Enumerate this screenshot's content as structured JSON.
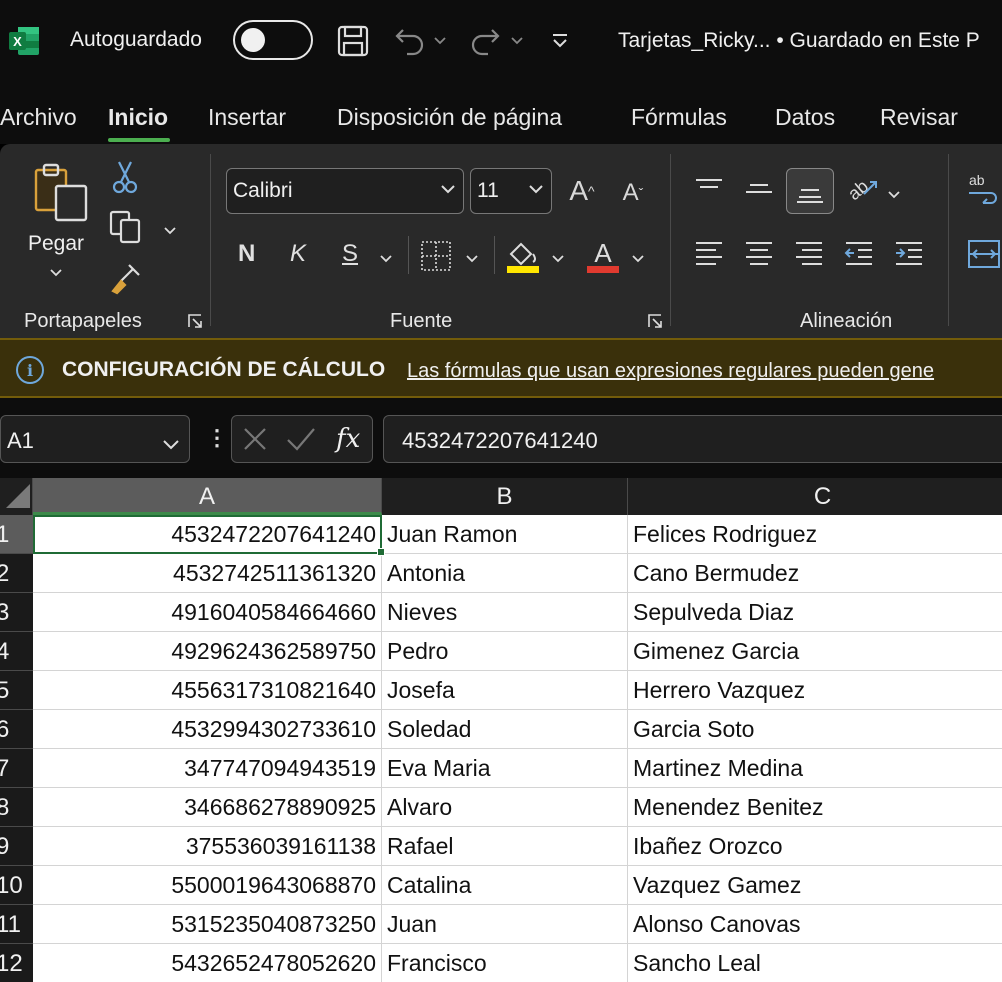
{
  "title_bar": {
    "app_icon": "excel-logo-icon",
    "autosave_label": "Autoguardado",
    "autosave_on": false,
    "document_title": "Tarjetas_Ricky...  •  Guardado en Este P"
  },
  "menu_tabs": [
    {
      "label": "Archivo",
      "active": false
    },
    {
      "label": "Inicio",
      "active": true
    },
    {
      "label": "Insertar",
      "active": false
    },
    {
      "label": "Disposición de página",
      "active": false
    },
    {
      "label": "Fórmulas",
      "active": false
    },
    {
      "label": "Datos",
      "active": false
    },
    {
      "label": "Revisar",
      "active": false
    }
  ],
  "ribbon": {
    "clipboard": {
      "paste_label": "Pegar",
      "group_label": "Portapapeles"
    },
    "font": {
      "font_name": "Calibri",
      "font_size": "11",
      "bold_label": "N",
      "italic_label": "K",
      "underline_label": "S",
      "group_label": "Fuente",
      "highlight_color": "#ffe600",
      "font_color": "#e03a2f"
    },
    "alignment": {
      "group_label": "Alineación"
    }
  },
  "info_bar": {
    "icon": "info-icon",
    "title": "CONFIGURACIÓN DE CÁLCULO",
    "message": "Las fórmulas que usan expresiones regulares pueden gene"
  },
  "formula_bar": {
    "name_box": "A1",
    "formula": "4532472207641240"
  },
  "grid": {
    "columns": [
      "A",
      "B",
      "C"
    ],
    "rows": [
      {
        "num": "1",
        "a": "4532472207641240",
        "b": "Juan Ramon",
        "c": "Felices Rodriguez"
      },
      {
        "num": "2",
        "a": "4532742511361320",
        "b": "Antonia",
        "c": "Cano Bermudez"
      },
      {
        "num": "3",
        "a": "4916040584664660",
        "b": "Nieves",
        "c": "Sepulveda Diaz"
      },
      {
        "num": "4",
        "a": "4929624362589750",
        "b": "Pedro",
        "c": "Gimenez Garcia"
      },
      {
        "num": "5",
        "a": "4556317310821640",
        "b": "Josefa",
        "c": "Herrero Vazquez"
      },
      {
        "num": "6",
        "a": "4532994302733610",
        "b": "Soledad",
        "c": "Garcia Soto"
      },
      {
        "num": "7",
        "a": "347747094943519",
        "b": "Eva Maria",
        "c": "Martinez Medina"
      },
      {
        "num": "8",
        "a": "346686278890925",
        "b": "Alvaro",
        "c": "Menendez Benitez"
      },
      {
        "num": "9",
        "a": "375536039161138",
        "b": "Rafael",
        "c": "Ibañez Orozco"
      },
      {
        "num": "10",
        "a": "5500019643068870",
        "b": "Catalina",
        "c": "Vazquez Gamez"
      },
      {
        "num": "11",
        "a": "5315235040873250",
        "b": "Juan",
        "c": "Alonso Canovas"
      },
      {
        "num": "12",
        "a": "5432652478052620",
        "b": "Francisco",
        "c": "Sancho Leal"
      }
    ]
  }
}
